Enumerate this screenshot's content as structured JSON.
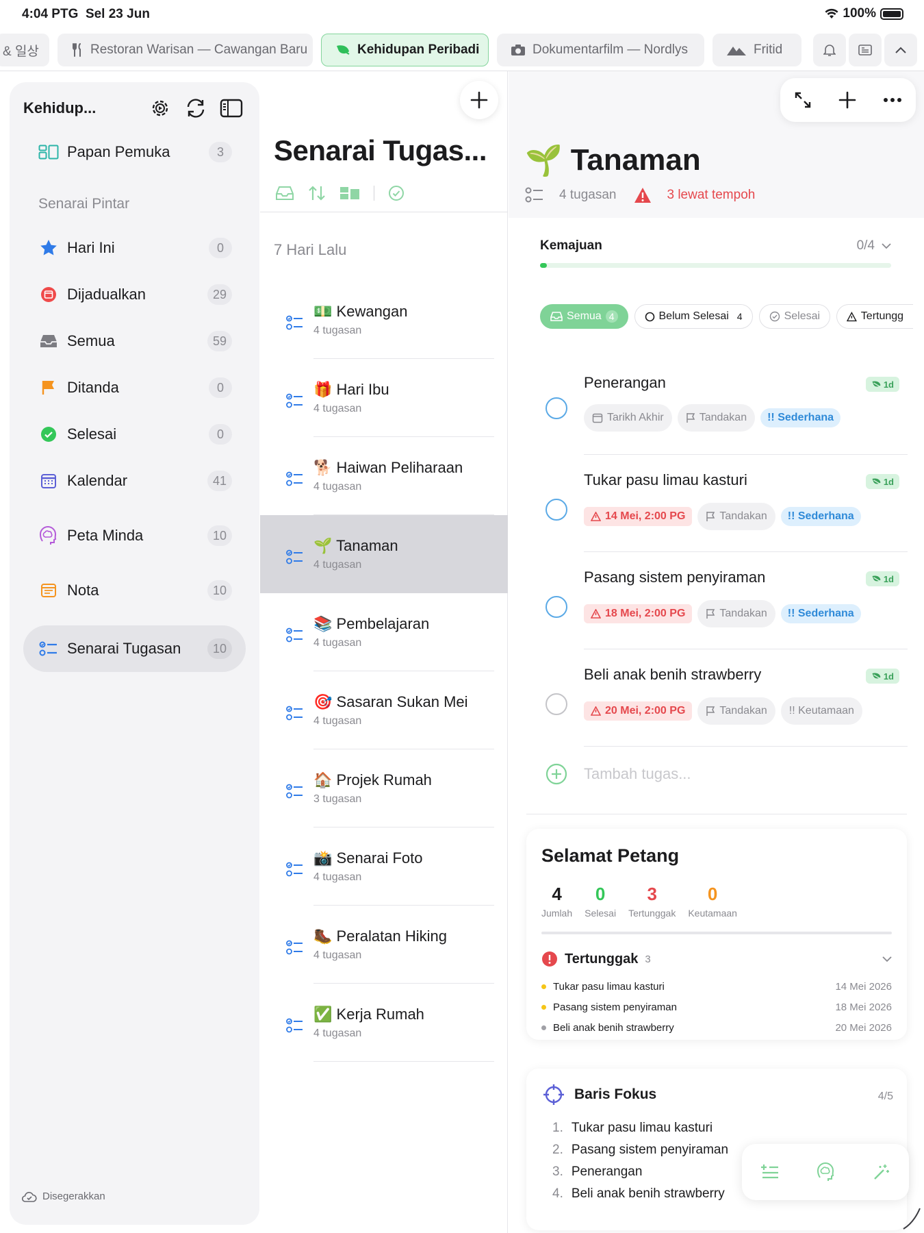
{
  "status_bar": {
    "time": "4:04 PTG",
    "date": "Sel 23 Jun",
    "battery": "100%"
  },
  "tabs": [
    {
      "label": "& 일상"
    },
    {
      "label": "Restoran Warisan — Cawangan Baru"
    },
    {
      "label": "Kehidupan Peribadi"
    },
    {
      "label": "Dokumentarfilm — Nordlys"
    },
    {
      "label": "Fritid"
    }
  ],
  "sidebar": {
    "title": "Kehidup...",
    "top_item": {
      "label": "Papan Pemuka",
      "count": "3"
    },
    "smart_header": "Senarai Pintar",
    "items": [
      {
        "label": "Hari Ini",
        "count": "0"
      },
      {
        "label": "Dijadualkan",
        "count": "29"
      },
      {
        "label": "Semua",
        "count": "59"
      },
      {
        "label": "Ditanda",
        "count": "0"
      },
      {
        "label": "Selesai",
        "count": "0"
      },
      {
        "label": "Kalendar",
        "count": "41"
      },
      {
        "label": "Peta Minda",
        "count": "10"
      },
      {
        "label": "Nota",
        "count": "10"
      },
      {
        "label": "Senarai Tugasan",
        "count": "10"
      }
    ],
    "sync_status": "Disegerakkan"
  },
  "middle": {
    "title": "Senarai Tugas...",
    "section": "7 Hari Lalu",
    "lists": [
      {
        "emoji": "💵",
        "title": "Kewangan",
        "sub": "4 tugasan"
      },
      {
        "emoji": "🎁",
        "title": "Hari Ibu",
        "sub": "4 tugasan"
      },
      {
        "emoji": "🐕",
        "title": "Haiwan Peliharaan",
        "sub": "4 tugasan"
      },
      {
        "emoji": "🌱",
        "title": "Tanaman",
        "sub": "4 tugasan"
      },
      {
        "emoji": "📚",
        "title": "Pembelajaran",
        "sub": "4 tugasan"
      },
      {
        "emoji": "🎯",
        "title": "Sasaran Sukan Mei",
        "sub": "4 tugasan"
      },
      {
        "emoji": "🏠",
        "title": "Projek Rumah",
        "sub": "3 tugasan"
      },
      {
        "emoji": "📸",
        "title": "Senarai Foto",
        "sub": "4 tugasan"
      },
      {
        "emoji": "🥾",
        "title": "Peralatan Hiking",
        "sub": "4 tugasan"
      },
      {
        "emoji": "✅",
        "title": "Kerja Rumah",
        "sub": "4 tugasan"
      }
    ]
  },
  "detail": {
    "emoji": "🌱",
    "title": "Tanaman",
    "task_count": "4 tugasan",
    "overdue": "3 lewat tempoh",
    "progress_label": "Kemajuan",
    "progress_value": "0/4",
    "progress_fraction": 0.02,
    "filters": {
      "all": "Semua",
      "all_count": "4",
      "open": "Belum Selesai",
      "open_count": "4",
      "done": "Selesai",
      "overdue": "Tertungg"
    },
    "tasks": [
      {
        "title": "Penerangan",
        "badge": "1d",
        "date": "Tarikh Akhir",
        "flag": "Tandakan",
        "priority": "!! Sederhana"
      },
      {
        "title": "Tukar pasu limau kasturi",
        "badge": "1d",
        "date": "14 Mei, 2:00 PG",
        "flag": "Tandakan",
        "priority": "!! Sederhana"
      },
      {
        "title": "Pasang sistem penyiraman",
        "badge": "1d",
        "date": "18 Mei, 2:00 PG",
        "flag": "Tandakan",
        "priority": "!! Sederhana"
      },
      {
        "title": "Beli anak benih strawberry",
        "badge": "1d",
        "date": "20 Mei, 2:00 PG",
        "flag": "Tandakan",
        "priority": "!! Keutamaan"
      }
    ],
    "add_placeholder": "Tambah tugas..."
  },
  "summary": {
    "greeting": "Selamat Petang",
    "stats": [
      {
        "value": "4",
        "label": "Jumlah"
      },
      {
        "value": "0",
        "label": "Selesai"
      },
      {
        "value": "3",
        "label": "Tertunggak"
      },
      {
        "value": "0",
        "label": "Keutamaan"
      }
    ],
    "overdue_title": "Tertunggak",
    "overdue_count": "3",
    "overdue_items": [
      {
        "title": "Tukar pasu limau kasturi",
        "date": "14 Mei 2026"
      },
      {
        "title": "Pasang sistem penyiraman",
        "date": "18 Mei 2026"
      },
      {
        "title": "Beli anak benih strawberry",
        "date": "20 Mei 2026"
      }
    ]
  },
  "focus": {
    "title": "Baris Fokus",
    "count": "4/5",
    "items": [
      {
        "num": "1.",
        "title": "Tukar pasu limau kasturi"
      },
      {
        "num": "2.",
        "title": "Pasang sistem penyiraman"
      },
      {
        "num": "3.",
        "title": "Penerangan"
      },
      {
        "num": "4.",
        "title": "Beli anak benih strawberry"
      }
    ]
  },
  "colors": {
    "accent": "#34c759",
    "danger": "#e5484d",
    "info": "#2f8ad8",
    "selected_row": "#d7d7dc"
  }
}
